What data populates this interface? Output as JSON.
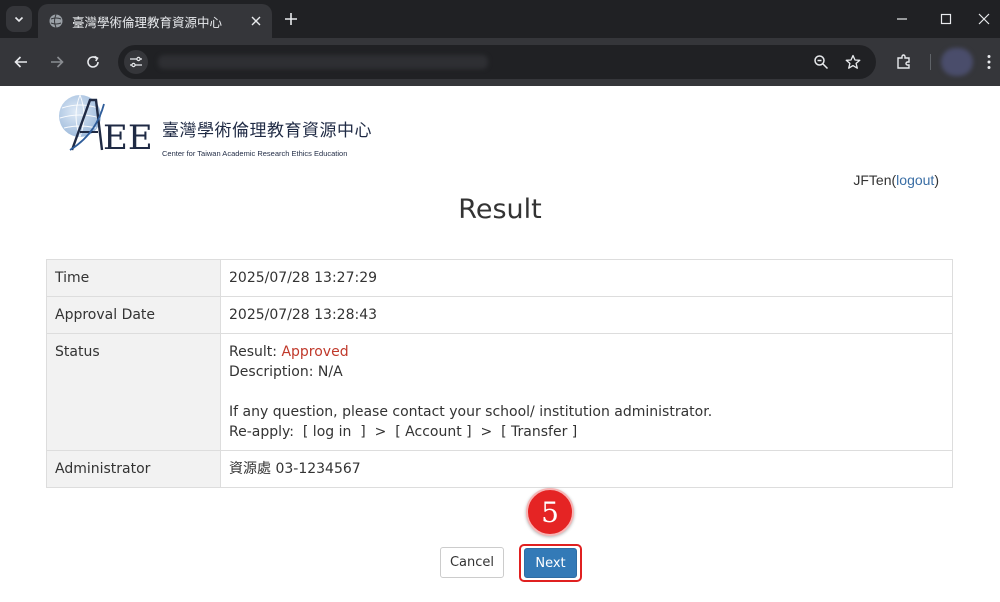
{
  "browser": {
    "tab_title": "臺灣學術倫理教育資源中心"
  },
  "logo": {
    "mark_text": "AREE",
    "name_cn": "臺灣學術倫理教育資源中心",
    "name_en": "Center for Taiwan Academic Research Ethics Education"
  },
  "user": {
    "name": "JFTen",
    "open_paren": "(",
    "logout_label": "logout",
    "close_paren": ")"
  },
  "page": {
    "title": "Result"
  },
  "table": {
    "time_label": "Time",
    "time_value": "2025/07/28 13:27:29",
    "approval_label": "Approval Date",
    "approval_value": "2025/07/28 13:28:43",
    "status_label": "Status",
    "result_prefix": "Result: ",
    "result_value": "Approved",
    "description": "Description: N/A",
    "question_line": "If any question, please contact your school/ institution administrator.",
    "reapply_line": "Re-apply:  [ log in  ]  >  [ Account ]  >  [ Transfer ]",
    "admin_label": "Administrator",
    "admin_value": "資源處 03-1234567"
  },
  "actions": {
    "cancel_label": "Cancel",
    "next_label": "Next"
  },
  "annotation": {
    "step_number": "5"
  },
  "colors": {
    "approved": "#c0392b",
    "next_button": "#337ab7",
    "highlight": "#e02020",
    "link": "#3a6ea5"
  }
}
